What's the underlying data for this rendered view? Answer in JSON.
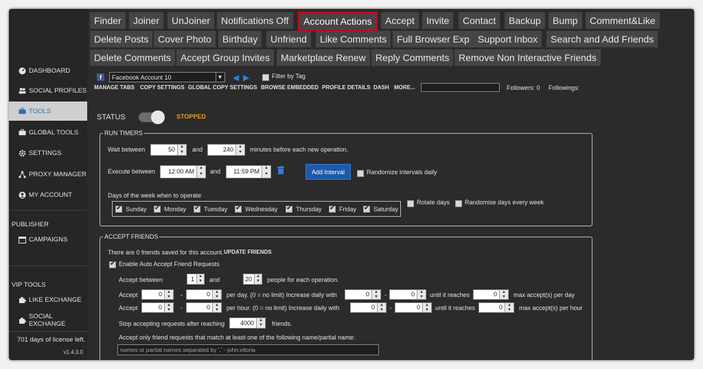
{
  "sidebar": {
    "items": [
      {
        "label": "DASHBOARD",
        "icon": "dashboard-icon"
      },
      {
        "label": "SOCIAL PROFILES",
        "icon": "users-icon"
      },
      {
        "label": "TOOLS",
        "icon": "toolbox-icon"
      },
      {
        "label": "GLOBAL TOOLS",
        "icon": "toolbox-icon"
      },
      {
        "label": "SETTINGS",
        "icon": "gear-icon"
      },
      {
        "label": "PROXY MANAGER",
        "icon": "network-icon"
      },
      {
        "label": "MY ACCOUNT",
        "icon": "user-icon"
      }
    ],
    "publisher_title": "PUBLISHER",
    "campaigns": "CAMPAIGNS",
    "vip_title": "VIP TOOLS",
    "like_exchange": "LIKE EXCHANGE",
    "social_exchange": "SOCIAL EXCHANGE",
    "license": "701 days of license left.",
    "version": "v1.4.3.0"
  },
  "tabs": {
    "row1": [
      "Finder",
      "Joiner",
      "UnJoiner",
      "Notifications Off",
      "Account Actions",
      "Accept",
      "Invite",
      "Contact",
      "Backup",
      "Bump",
      "Comment&Like"
    ],
    "row2": [
      "Delete Posts",
      "Cover Photo",
      "Birthday",
      "Unfriend",
      "Like Comments",
      "Full Browser Exp",
      "Support Inbox",
      "Search and Add Friends"
    ],
    "row3": [
      "Delete Comments",
      "Accept Group Invites",
      "Marketplace Renew",
      "Reply Comments",
      "Remove Non Interactive Friends"
    ],
    "selected": "Account Actions"
  },
  "account": {
    "selected": "Facebook Account 10",
    "filter_by_tag": "Filter by Tag",
    "links": [
      "MANAGE TABS",
      "COPY SETTINGS",
      "GLOBAL COPY SETTINGS",
      "BROWSE EMBEDDED",
      "PROFILE DETAILS",
      "DASH",
      "MORE..."
    ],
    "followers": "Followers: 0",
    "followings": "Followings:"
  },
  "status": {
    "label": "STATUS",
    "value": "STOPPED",
    "value_color": "#e0a020"
  },
  "run_timers": {
    "title": "RUN TIMERS",
    "wait_label": "Wait between",
    "wait_min": "50",
    "and": "and",
    "wait_max": "240",
    "wait_suffix": "minutes before each new operation.",
    "execute_label": "Execute between",
    "exec_start": "12:00 AM",
    "exec_end": "11:59 PM",
    "add_interval": "Add Interval",
    "randomize_intervals": "Randomize intervals daily",
    "days_label": "Days of the week when to operate",
    "days": [
      "Sunday",
      "Monday",
      "Tuesday",
      "Wednesday",
      "Thursday",
      "Friday",
      "Saturday"
    ],
    "rotate_days": "Rotate days",
    "randomise_days": "Randomise days every week"
  },
  "accept_friends": {
    "title": "ACCEPT FRIENDS",
    "saved_text": "There are 0 friends saved for this account.",
    "update_friends": "UPDATE FRIENDS",
    "enable_auto": "Enable Auto Accept Friend Requests",
    "accept_between": "Accept between",
    "between_min": "1",
    "and": "and",
    "between_max": "20",
    "people_suffix": "people for each operation.",
    "accept": "Accept",
    "dash": "-",
    "zero": "0",
    "per_day": "per day. (0 = no limit)  Increase daily with",
    "per_hour": "per hour. (0 = no limit)  Increase daily with",
    "until_reaches": "until it reaches",
    "max_per_day": "max accept(s) per day",
    "max_per_hour": "max accept(s) per hour",
    "stop_label": "Stop accepting requests after reaching",
    "stop_value": "4000",
    "friends": "friends.",
    "match_label": "Accept only friend requests that match at least one of the following name/partial name:",
    "names_placeholder": "names or partial names separated by ','  -  john,vitoria"
  }
}
